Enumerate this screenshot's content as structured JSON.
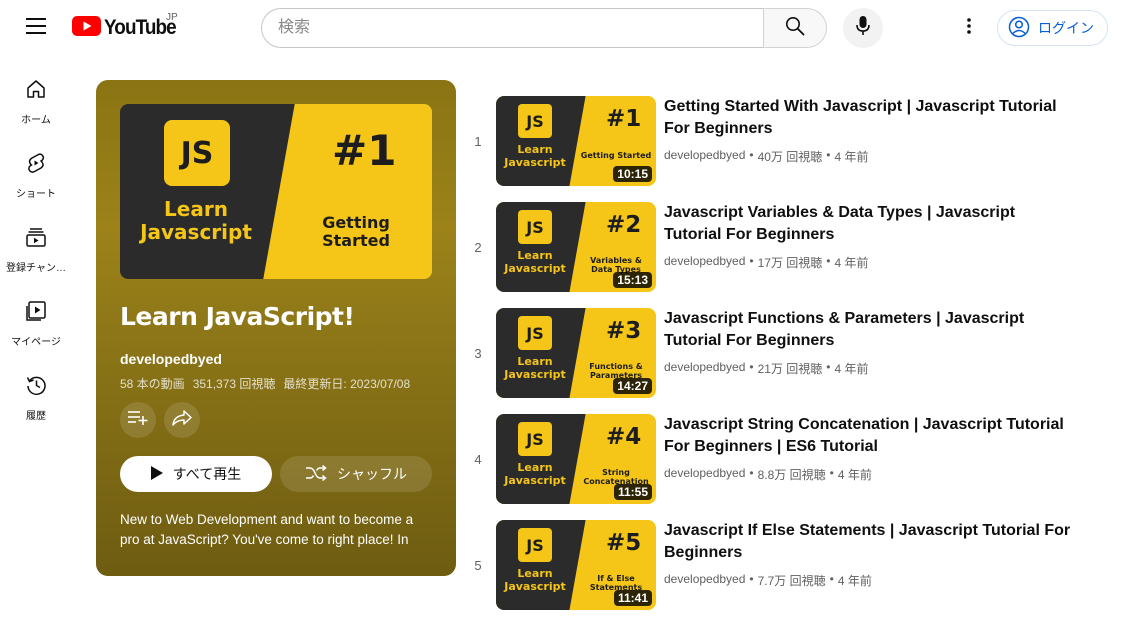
{
  "header": {
    "logo_text": "YouTube",
    "region": "JP",
    "search_placeholder": "検索",
    "login_label": "ログイン"
  },
  "sidebar": {
    "items": [
      {
        "label": "ホーム",
        "icon": "home-icon"
      },
      {
        "label": "ショート",
        "icon": "shorts-icon"
      },
      {
        "label": "登録チャン…",
        "icon": "subscriptions-icon"
      },
      {
        "label": "マイページ",
        "icon": "library-icon"
      },
      {
        "label": "履歴",
        "icon": "history-icon"
      }
    ]
  },
  "playlist": {
    "title": "Learn JavaScript!",
    "owner": "developedbyed",
    "video_count": "58 本の動画",
    "views": "351,373 回視聴",
    "updated": "最終更新日: 2023/07/08",
    "play_all_label": "すべて再生",
    "shuffle_label": "シャッフル",
    "description": "New to Web Development and want to become a pro at JavaScript? You've come to right place! In",
    "cover": {
      "badge": "JS",
      "learn": "Learn",
      "javascript": "Javascript",
      "number": "#1",
      "subtitle": "Getting Started"
    }
  },
  "colors": {
    "thumb_yellow": "#f5c518",
    "thumb_dark": "#2b2b2b",
    "panel_bg": "#9c8219",
    "link_blue": "#065fd4"
  },
  "videos": [
    {
      "index": "1",
      "title": "Getting Started With Javascript | Javascript Tutorial For Beginners",
      "channel": "developedbyed",
      "views": "40万 回視聴",
      "age": "4 年前",
      "duration": "10:15",
      "thumb_number": "#1",
      "thumb_sub": "Getting Started"
    },
    {
      "index": "2",
      "title": "Javascript Variables & Data Types | Javascript Tutorial For Beginners",
      "channel": "developedbyed",
      "views": "17万 回視聴",
      "age": "4 年前",
      "duration": "15:13",
      "thumb_number": "#2",
      "thumb_sub": "Variables & Data Types"
    },
    {
      "index": "3",
      "title": "Javascript Functions & Parameters | Javascript Tutorial For Beginners",
      "channel": "developedbyed",
      "views": "21万 回視聴",
      "age": "4 年前",
      "duration": "14:27",
      "thumb_number": "#3",
      "thumb_sub": "Functions & Parameters"
    },
    {
      "index": "4",
      "title": "Javascript String Concatenation | Javascript Tutorial For Beginners | ES6 Tutorial",
      "channel": "developedbyed",
      "views": "8.8万 回視聴",
      "age": "4 年前",
      "duration": "11:55",
      "thumb_number": "#4",
      "thumb_sub": "String Concatenation"
    },
    {
      "index": "5",
      "title": "Javascript If Else Statements | Javascript Tutorial For Beginners",
      "channel": "developedbyed",
      "views": "7.7万 回視聴",
      "age": "4 年前",
      "duration": "11:41",
      "thumb_number": "#5",
      "thumb_sub": "If & Else Statements"
    }
  ],
  "thumb_common": {
    "badge": "JS",
    "learn": "Learn",
    "javascript": "Javascript"
  }
}
